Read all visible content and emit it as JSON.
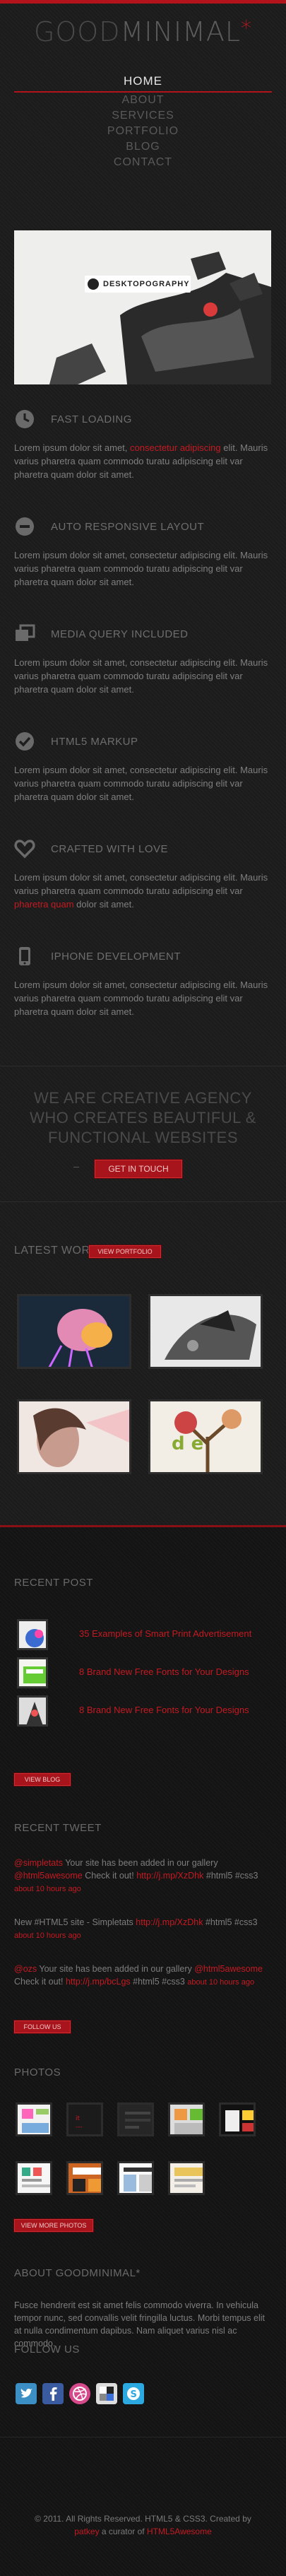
{
  "header": {
    "logo_part1": "GOOD",
    "logo_part2": "MINIMAL",
    "logo_mark": "*"
  },
  "nav": {
    "items": [
      "HOME",
      "ABOUT",
      "SERVICES",
      "PORTFOLIO",
      "BLOG",
      "CONTACT"
    ]
  },
  "hero": {
    "brand": "DESKTOPOGRAPHY"
  },
  "features": [
    {
      "title": "FAST LOADING",
      "text_a": "Lorem ipsum dolor sit amet, ",
      "link": "consectetur adipiscing",
      "text_b": " elit. Mauris varius pharetra quam commodo turatu adipiscing elit var pharetra quam dolor sit amet."
    },
    {
      "title": "AUTO RESPONSIVE LAYOUT",
      "text_a": "Lorem ipsum dolor sit amet, consectetur adipiscing elit. Mauris varius pharetra quam commodo turatu adipiscing elit var pharetra quam dolor sit amet.",
      "link": "",
      "text_b": ""
    },
    {
      "title": "MEDIA QUERY INCLUDED",
      "text_a": "Lorem ipsum dolor sit amet, consectetur adipiscing elit. Mauris varius pharetra quam commodo turatu adipiscing elit var pharetra quam dolor sit amet.",
      "link": "",
      "text_b": ""
    },
    {
      "title": "HTML5 MARKUP",
      "text_a": "Lorem ipsum dolor sit amet, consectetur adipiscing elit. Mauris varius pharetra quam commodo turatu adipiscing elit var pharetra quam dolor sit amet.",
      "link": "",
      "text_b": ""
    },
    {
      "title": "CRAFTED WITH LOVE",
      "text_a": "Lorem ipsum dolor sit amet, consectetur adipiscing elit. Mauris varius pharetra quam commodo turatu adipiscing elit var ",
      "link": "pharetra quam",
      "text_b": " dolor sit amet."
    },
    {
      "title": "IPHONE DEVELOPMENT",
      "text_a": "Lorem ipsum dolor sit amet, consectetur adipiscing elit. Mauris varius pharetra quam commodo turatu adipiscing elit var pharetra quam dolor sit amet.",
      "link": "",
      "text_b": ""
    }
  ],
  "cta": {
    "headline": "WE ARE CREATIVE AGENCY WHO CREATES BEAUTIFUL & FUNCTIONAL WEBSITES",
    "button": "GET IN TOUCH"
  },
  "latest_work": {
    "title": "LATEST WORK",
    "button": "VIEW PORTFOLIO"
  },
  "recent_post": {
    "title": "RECENT POST",
    "posts": [
      "35 Examples of Smart Print Advertisement",
      "8 Brand New Free Fonts for Your Designs",
      "8 Brand New Free Fonts for Your Designs"
    ],
    "button": "VIEW BLOG"
  },
  "recent_tweet": {
    "title": "RECENT TWEET",
    "tweets": [
      {
        "h1": "@simpletats",
        "t1": " Your site has been added in our gallery ",
        "h2": "@html5awesome",
        "t2": " Check it out! ",
        "h3": "http://j.mp/XzDhk",
        "t3": " #html5 #css3 ",
        "time": "about 10 hours ago"
      },
      {
        "h1": "",
        "t1": "New #HTML5 site - Simpletats ",
        "h2": "",
        "t2": "",
        "h3": "http://j.mp/XzDhk",
        "t3": " #html5 #css3 ",
        "time": "about 10 hours ago"
      },
      {
        "h1": "@ozs",
        "t1": " Your site has been added in our gallery ",
        "h2": "@html5awesome",
        "t2": " Check it out! ",
        "h3": "http://j.mp/bcLgs",
        "t3": " #html5 #css3 ",
        "time": "about 10 hours ago"
      }
    ],
    "button": "FOLLOW US"
  },
  "photos": {
    "title": "PHOTOS",
    "button": "VIEW MORE PHOTOS"
  },
  "about": {
    "title": "ABOUT GOODMINIMAL*",
    "text": "Fusce hendrerit est sit amet felis commodo viverra. In vehicula tempor nunc, sed convallis velit fringilla luctus. Morbi tempus elit at nulla condimentum dapibus. Nam aliquet varius nisl ac commodo."
  },
  "follow": {
    "title": "FOLLOW US",
    "icons": [
      "twitter-icon",
      "facebook-icon",
      "dribbble-icon",
      "delicious-icon",
      "skype-icon"
    ]
  },
  "footer": {
    "copyright": "© 2011. All Rights Reserved. HTML5 & CSS3. Created by",
    "author": "patkey",
    "sep": " a curator of ",
    "site": "HTML5Awesome"
  },
  "colors": {
    "accent": "#c41a22",
    "background": "#1e1e1e"
  }
}
